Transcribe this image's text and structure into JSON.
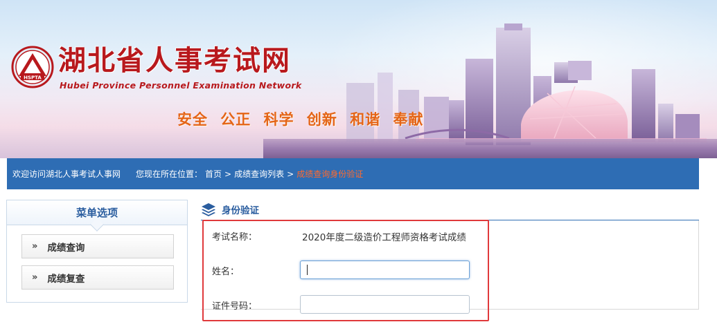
{
  "banner": {
    "title": "湖北省人事考试网",
    "subtitle": "Hubei Province Personnel Examination Network",
    "logo_text": "HSPTA",
    "slogan": "安全 公正 科学 创新 和谐 奉献"
  },
  "navbar": {
    "welcome": "欢迎访问湖北人事考试人事网",
    "location_label": "您现在所在位置：",
    "breadcrumbs": [
      "首页",
      "成绩查询列表",
      "成绩查询身份验证"
    ],
    "separator": ">"
  },
  "sidebar": {
    "title": "菜单选项",
    "items": [
      {
        "label": "成绩查询"
      },
      {
        "label": "成绩复查"
      }
    ],
    "bullet": "»"
  },
  "main": {
    "section_title": "身份验证",
    "exam_label": "考试名称：",
    "exam_value": "2020年度二级造价工程师资格考试成绩",
    "name_label": "姓名：",
    "name_value": "",
    "id_label": "证件号码：",
    "id_value": ""
  },
  "colors": {
    "nav_bg": "#2e6db4",
    "brand_red": "#b8191d",
    "slogan_orange": "#e46417",
    "breadcrumb_current": "#ff6a2e",
    "highlight_border": "#e0393b"
  }
}
